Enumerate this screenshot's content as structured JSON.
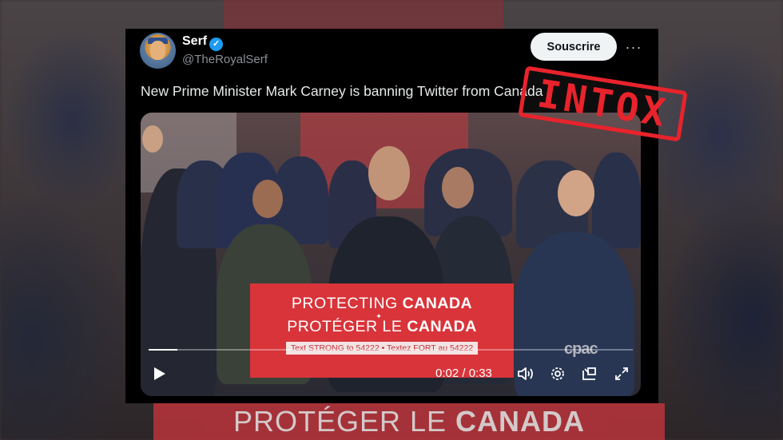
{
  "tweet": {
    "display_name": "Serf",
    "handle": "@TheRoyalSerf",
    "subscribe_label": "Souscrire",
    "more_label": "···",
    "text": "New Prime Minister Mark Carney is banning Twitter from Canada",
    "verified_icon": "check-icon"
  },
  "video": {
    "podium_line1_light": "PROTECTING ",
    "podium_line1_bold": "CANADA",
    "podium_line2_light": "PROTÉGER LE ",
    "podium_line2_bold": "CANADA",
    "podium_line3": "Text STRONG to 54222 • Textez FORT au 54222",
    "watermark": "cpac",
    "time": "0:02 / 0:33",
    "progress": 0.06,
    "controls": {
      "play_icon": "play-icon",
      "volume_icon": "volume-icon",
      "settings_icon": "gear-icon",
      "pip_icon": "picture-in-picture-icon",
      "fullscreen_icon": "fullscreen-icon"
    }
  },
  "background": {
    "banner_light": "PROTÉGER LE ",
    "banner_bold": "CANADA"
  },
  "stamp": "INTOX",
  "colors": {
    "card_bg": "#000000",
    "accent_blue": "#1d9bf0",
    "podium_red": "#d8343a",
    "stamp_red": "#e8232c"
  }
}
